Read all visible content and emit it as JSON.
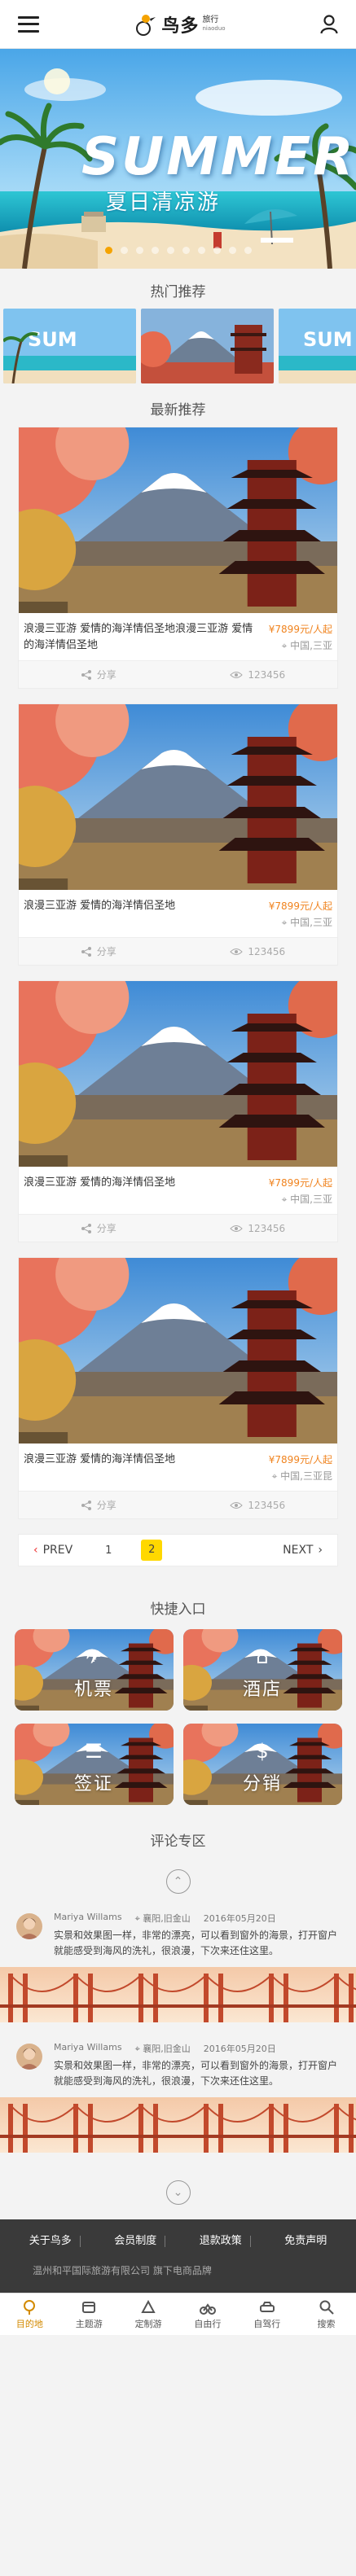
{
  "header": {
    "logo_text": "鸟多",
    "logo_sub": "旅行",
    "logo_tag": "niaoduo"
  },
  "banner": {
    "summer_text": "SUMMER",
    "title": "夏日清凉游",
    "dot_count": 10,
    "active_dot": 0
  },
  "hot": {
    "title": "热门推荐"
  },
  "latest": {
    "title": "最新推荐",
    "items": [
      {
        "title": "浪漫三亚游 爱情的海洋情侣圣地浪漫三亚游 爱情的海洋情侣圣地",
        "price": "¥7899元/人起",
        "location": "中国,三亚",
        "share": "分享",
        "views": "123456"
      },
      {
        "title": "浪漫三亚游 爱情的海洋情侣圣地",
        "price": "¥7899元/人起",
        "location": "中国,三亚",
        "share": "分享",
        "views": "123456"
      },
      {
        "title": "浪漫三亚游 爱情的海洋情侣圣地",
        "price": "¥7899元/人起",
        "location": "中国,三亚",
        "share": "分享",
        "views": "123456"
      },
      {
        "title": "浪漫三亚游 爱情的海洋情侣圣地",
        "price": "¥7899元/人起",
        "location": "中国,三亚昆",
        "share": "分享",
        "views": "123456"
      }
    ]
  },
  "pager": {
    "prev": "PREV",
    "next": "NEXT",
    "pages": [
      "1",
      "2"
    ],
    "current": "2"
  },
  "quick": {
    "title": "快捷入口",
    "items": [
      {
        "label": "机票",
        "icon": "airplane-icon"
      },
      {
        "label": "酒店",
        "icon": "hotel-icon"
      },
      {
        "label": "签证",
        "icon": "passport-icon"
      },
      {
        "label": "分销",
        "icon": "money-bag-icon"
      }
    ]
  },
  "comments": {
    "title": "评论专区",
    "items": [
      {
        "user": "Mariya Willams",
        "location": "襄阳,旧金山",
        "date": "2016年05月20日",
        "text": "实景和效果图一样，非常的漂亮，可以看到窗外的海景，打开窗户就能感受到海风的洗礼，很浪漫，下次来还住这里。"
      },
      {
        "user": "Mariya Willams",
        "location": "襄阳,旧金山",
        "date": "2016年05月20日",
        "text": "实景和效果图一样，非常的漂亮，可以看到窗外的海景，打开窗户就能感受到海风的洗礼，很浪漫，下次来还住这里。"
      }
    ]
  },
  "footer": {
    "links": [
      "关于鸟多",
      "会员制度",
      "退款政策",
      "免责声明"
    ],
    "copyright": "温州和平国际旅游有限公司 旗下电商品牌"
  },
  "tabbar": {
    "items": [
      {
        "label": "目的地",
        "icon": "destination-icon"
      },
      {
        "label": "主题游",
        "icon": "theme-icon"
      },
      {
        "label": "定制游",
        "icon": "custom-icon"
      },
      {
        "label": "自由行",
        "icon": "bike-icon"
      },
      {
        "label": "自驾行",
        "icon": "car-icon"
      },
      {
        "label": "搜索",
        "icon": "search-icon"
      }
    ],
    "active_index": 0
  },
  "colors": {
    "accent": "#f5a300",
    "price": "#f0831e",
    "footer_bg": "#3a3a3a",
    "page_bg": "#f3f3f3"
  }
}
